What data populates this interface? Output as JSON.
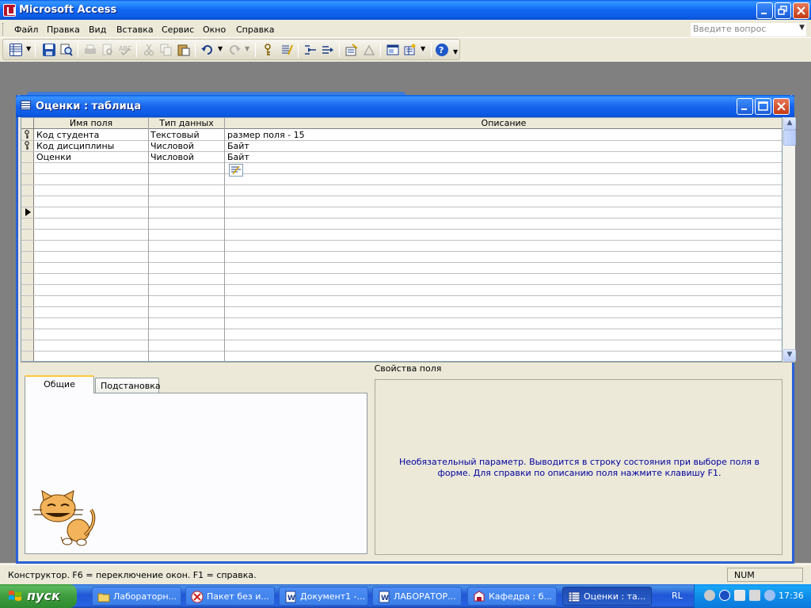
{
  "window": {
    "title": "Microsoft Access"
  },
  "menu": {
    "items": [
      "Файл",
      "Правка",
      "Вид",
      "Вставка",
      "Сервис",
      "Окно",
      "Справка"
    ],
    "ask_placeholder": "Введите вопрос"
  },
  "toolbar": {
    "icons": [
      "view-icon",
      "save-icon",
      "search-icon",
      "print-icon",
      "print-preview-icon",
      "spelling-icon",
      "cut-icon",
      "copy-icon",
      "paste-icon",
      "undo-icon",
      "redo-icon",
      "primary-key-icon",
      "indexes-icon",
      "insert-rows-icon",
      "delete-rows-icon",
      "properties-icon",
      "build-icon",
      "database-window-icon",
      "new-object-icon",
      "help-icon"
    ]
  },
  "table_window": {
    "title": "Оценки : таблица",
    "columns": [
      "Имя поля",
      "Тип данных",
      "Описание"
    ],
    "rows": [
      {
        "name": "Код студента",
        "type": "Текстовый",
        "description": "размер поля - 15",
        "key": true
      },
      {
        "name": "Код дисциплины",
        "type": "Числовой",
        "description": "Байт",
        "key": true
      },
      {
        "name": "Оценки",
        "type": "Числовой",
        "description": "Байт",
        "key": false
      }
    ],
    "props_label": "Свойства поля",
    "tabs": [
      "Общие",
      "Подстановка"
    ],
    "help_text": "Необязательный параметр.  Выводится в строку состояния при выборе поля в форме.  Для справки по описанию поля нажмите клавишу F1."
  },
  "statusbar": {
    "text": "Конструктор.  F6 = переключение окон.  F1 = справка.",
    "num": "NUM"
  },
  "taskbar": {
    "start": "пуск",
    "tasks": [
      "Лабораторн...",
      "Пакет без и...",
      "Документ1 -...",
      "ЛАБОРАТОР...",
      "Кафедра : б...",
      "Оценки : та..."
    ],
    "lang": "RL",
    "clock": "17:36"
  },
  "colors": {
    "title_blue": "#0058e6",
    "taskbar_blue": "#2157d7",
    "start_green": "#3e9c3e",
    "help_text": "#0000a0"
  }
}
